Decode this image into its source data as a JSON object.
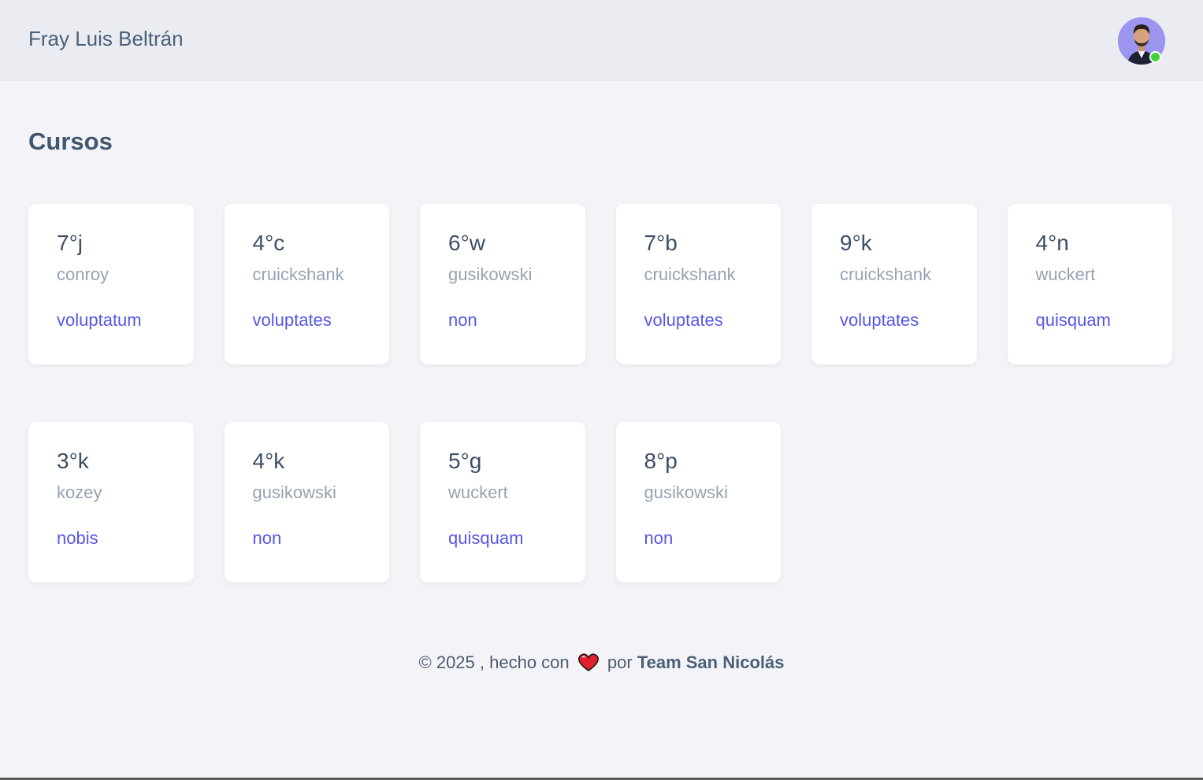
{
  "header": {
    "brand": "Fray Luis Beltrán",
    "avatar_icon": "user-avatar",
    "status_color": "#3ecf3a"
  },
  "main": {
    "title": "Cursos",
    "courses": [
      {
        "name": "7°j",
        "teacher": "conroy",
        "subject": "voluptatum"
      },
      {
        "name": "4°c",
        "teacher": "cruickshank",
        "subject": "voluptates"
      },
      {
        "name": "6°w",
        "teacher": "gusikowski",
        "subject": "non"
      },
      {
        "name": "7°b",
        "teacher": "cruickshank",
        "subject": "voluptates"
      },
      {
        "name": "9°k",
        "teacher": "cruickshank",
        "subject": "voluptates"
      },
      {
        "name": "4°n",
        "teacher": "wuckert",
        "subject": "quisquam"
      },
      {
        "name": "3°k",
        "teacher": "kozey",
        "subject": "nobis"
      },
      {
        "name": "4°k",
        "teacher": "gusikowski",
        "subject": "non"
      },
      {
        "name": "5°g",
        "teacher": "wuckert",
        "subject": "quisquam"
      },
      {
        "name": "8°p",
        "teacher": "gusikowski",
        "subject": "non"
      }
    ]
  },
  "footer": {
    "prefix": "© 2025 , hecho con",
    "heart_icon": "heart-icon",
    "por": "por",
    "team": "Team San Nicolás"
  },
  "colors": {
    "accent": "#5657e6",
    "heading": "#3f566e",
    "muted": "#96a2b2",
    "header_bg": "#ebecf1",
    "page_bg": "#f4f4f8"
  }
}
